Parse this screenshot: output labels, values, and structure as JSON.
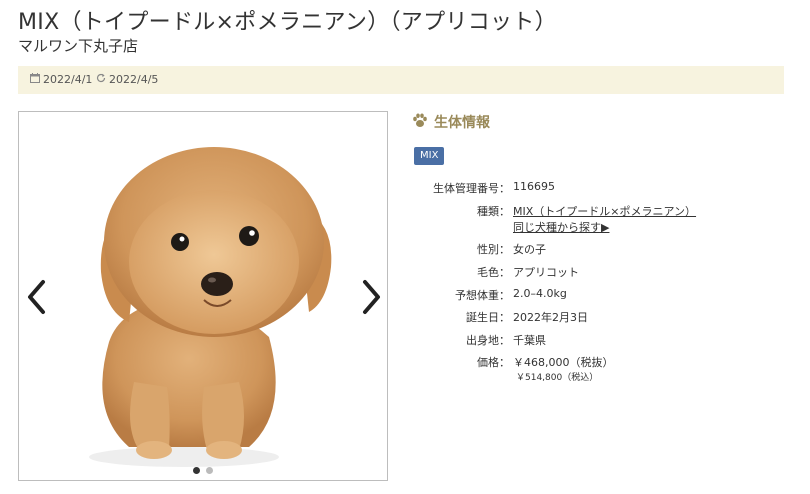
{
  "page": {
    "title": "MIX（トイプードル×ポメラニアン）（アプリコット）",
    "shop": "マルワン下丸子店"
  },
  "dates": {
    "created": "2022/4/1",
    "updated": "2022/4/5",
    "created_icon": "calendar-icon",
    "updated_icon": "refresh-icon"
  },
  "gallery": {
    "image_alt": "apricot toy poodle pomeranian mix puppy",
    "prev_icon": "chevron-left-icon",
    "next_icon": "chevron-right-icon",
    "slide_count": 2,
    "active_slide": 1
  },
  "info": {
    "heading": "生体情報",
    "heading_icon": "paw-icon",
    "badge": "MIX",
    "rows": [
      {
        "label": "生体管理番号：",
        "value": "116695"
      },
      {
        "label": "種類：",
        "value": "MIX（トイプードル×ポメラニアン）",
        "link": "同じ犬種から探す▶"
      },
      {
        "label": "性別：",
        "value": "女の子"
      },
      {
        "label": "毛色：",
        "value": "アプリコット"
      },
      {
        "label": "予想体重：",
        "value": "2.0–4.0kg"
      },
      {
        "label": "誕生日：",
        "value": "2022年2月3日"
      },
      {
        "label": "出身地：",
        "value": "千葉県"
      },
      {
        "label": "価格：",
        "value": "￥468,000（税抜）",
        "sub": "￥514,800（税込）"
      }
    ]
  },
  "colors": {
    "date_bar_bg": "#f7f3df",
    "badge_bg": "#4a6fa5",
    "heading": "#9a8a5a",
    "dot_active": "#333333",
    "dot_inactive": "#bbbbbb"
  }
}
